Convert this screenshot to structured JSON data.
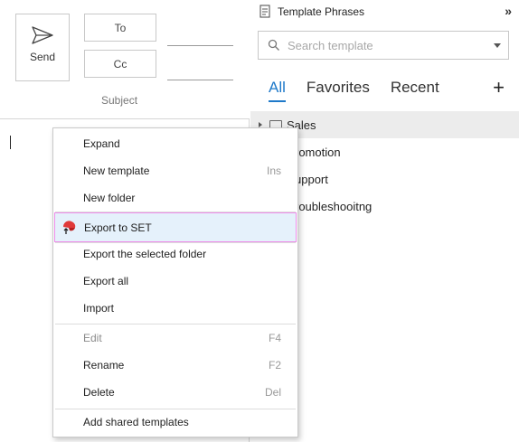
{
  "compose": {
    "send_label": "Send",
    "to_label": "To",
    "cc_label": "Cc",
    "subject_label": "Subject"
  },
  "pane": {
    "title": "Template Phrases",
    "collapse_glyph": "»",
    "search_placeholder": "Search template",
    "tabs": [
      "All",
      "Favorites",
      "Recent"
    ],
    "active_tab": "All",
    "add_glyph": "+",
    "tree": [
      "Sales",
      "romotion",
      "upport",
      "roubleshooitng"
    ]
  },
  "menu": {
    "items": [
      {
        "label": "Expand",
        "key": ""
      },
      {
        "label": "New template",
        "key": "Ins"
      },
      {
        "label": "New folder",
        "key": ""
      },
      {
        "label": "Export to SET",
        "key": "",
        "highlighted": true,
        "icon": "export-set-icon"
      },
      {
        "label": "Export the selected folder",
        "key": ""
      },
      {
        "label": "Export all",
        "key": ""
      },
      {
        "label": "Import",
        "key": ""
      },
      {
        "label": "Edit",
        "key": "F4",
        "disabled": true
      },
      {
        "label": "Rename",
        "key": "F2"
      },
      {
        "label": "Delete",
        "key": "Del"
      },
      {
        "label": "Add shared templates",
        "key": ""
      }
    ]
  },
  "colors": {
    "accent": "#1e79c9",
    "highlight_fill": "#e5f1fb",
    "highlight_border": "#ee8dea"
  }
}
